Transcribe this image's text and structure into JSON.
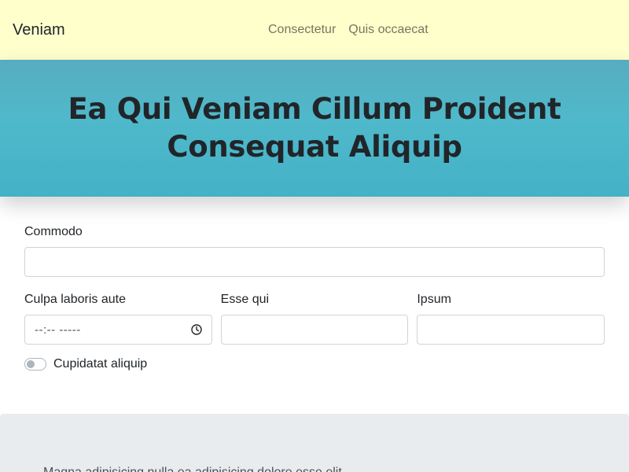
{
  "navbar": {
    "brand": "Veniam",
    "links": [
      "Consectetur",
      "Quis occaecat"
    ]
  },
  "hero": {
    "title": "Ea Qui Veniam Cillum Proident Consequat Aliquip"
  },
  "form": {
    "field_1": {
      "label": "Commodo",
      "value": ""
    },
    "field_2": {
      "label": "Culpa laboris aute",
      "value": "--:-- -----",
      "type": "time"
    },
    "field_3": {
      "label": "Esse qui",
      "value": ""
    },
    "field_4": {
      "label": "Ipsum",
      "value": ""
    },
    "switch": {
      "label": "Cupidatat aliquip",
      "checked": false
    }
  },
  "footer": {
    "text": "Magna adipisicing nulla ea adipisicing dolore esse elit"
  },
  "colors": {
    "navbar_bg": "#ffffcc",
    "hero_bg": "#4fb9cb",
    "footer_bg": "#e9ecef"
  },
  "icons": {
    "time_field": "clock-icon"
  }
}
